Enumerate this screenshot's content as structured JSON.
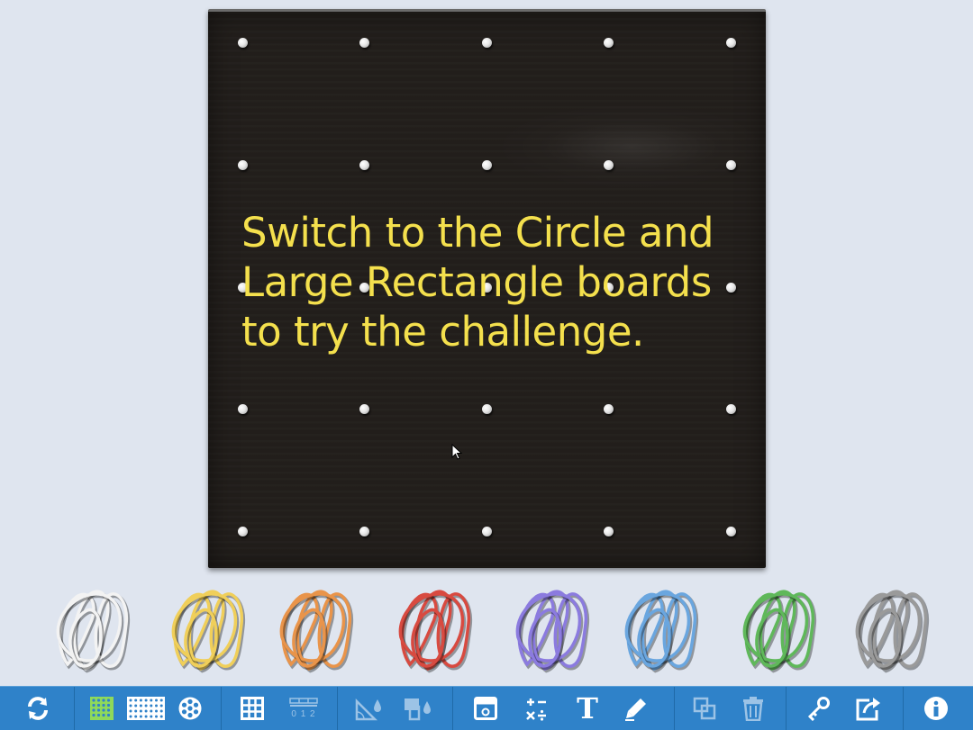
{
  "board": {
    "message": "Switch to the Circle and\nLarge Rectangle boards\nto try the challenge."
  },
  "band_colors": [
    {
      "name": "white",
      "color": "#f3f3f3"
    },
    {
      "name": "yellow",
      "color": "#f0cf5a"
    },
    {
      "name": "orange",
      "color": "#e9944a"
    },
    {
      "name": "red",
      "color": "#d84a40"
    },
    {
      "name": "purple",
      "color": "#8b7bdf"
    },
    {
      "name": "blue",
      "color": "#6aa6df"
    },
    {
      "name": "green",
      "color": "#5fb85a"
    },
    {
      "name": "gray",
      "color": "#9a9a9a"
    }
  ],
  "toolbar": {
    "background": "#2f82c9",
    "accent": "#8fd95a",
    "number_line_label": "0 1 2",
    "text_tool_label": "T"
  }
}
